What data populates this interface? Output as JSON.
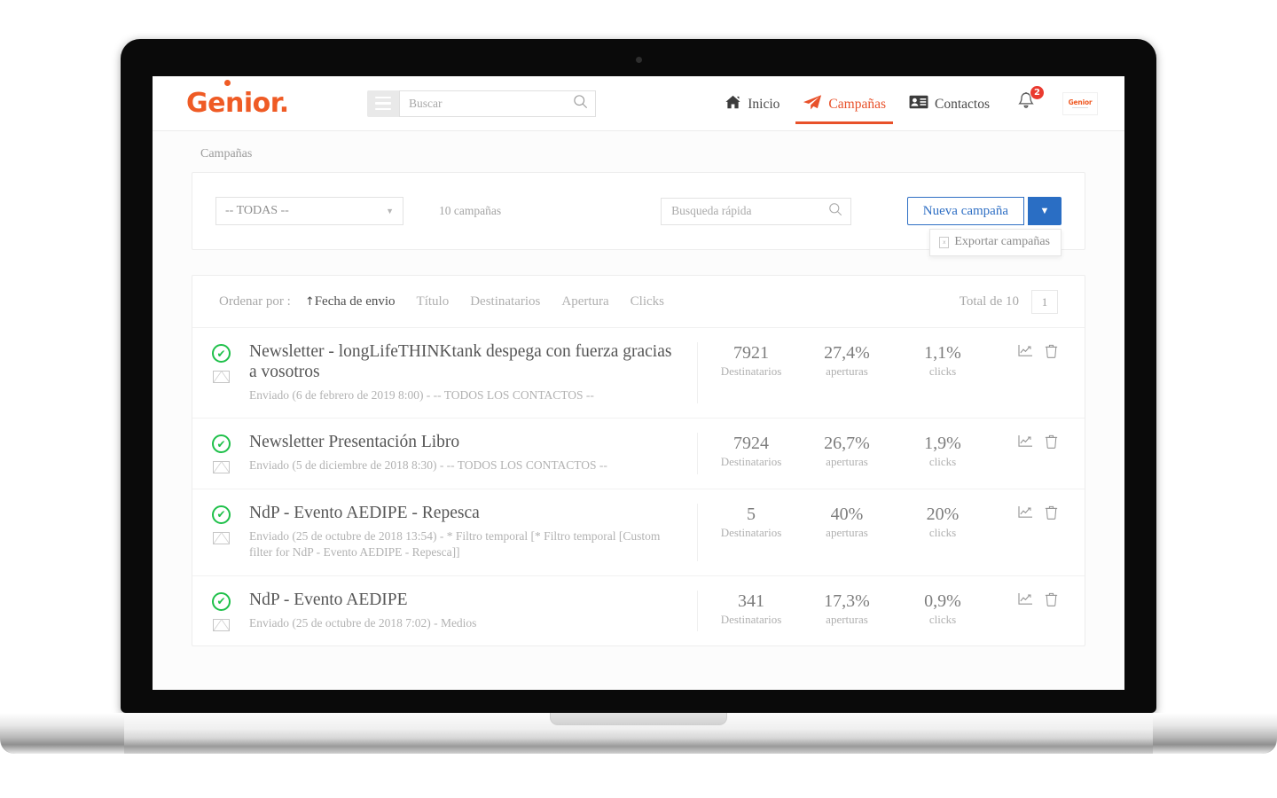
{
  "header": {
    "brand": "Genior",
    "brand_period": ".",
    "menu_icon": "hamburger-icon",
    "search_placeholder": "Buscar",
    "search_value": "",
    "nav": [
      {
        "label": "Inicio",
        "icon": "home-icon",
        "active": false
      },
      {
        "label": "Campañas",
        "icon": "paper-plane-icon",
        "active": true
      },
      {
        "label": "Contactos",
        "icon": "contact-card-icon",
        "active": false
      }
    ],
    "notifications_count": "2",
    "avatar_label": "Genior"
  },
  "breadcrumb": "Campañas",
  "filters": {
    "select_value": "-- TODAS --",
    "campaign_count": "10 campañas",
    "quick_search_placeholder": "Busqueda rápida",
    "quick_search_value": "",
    "new_campaign_label": "Nueva campaña",
    "dropdown_caret": "▼",
    "export_label": "Exportar campañas"
  },
  "sort": {
    "label": "Ordenar por :",
    "options": [
      {
        "label": "Fecha de envio",
        "active": true,
        "arrow": "↑"
      },
      {
        "label": "Título",
        "active": false,
        "arrow": ""
      },
      {
        "label": "Destinatarios",
        "active": false,
        "arrow": ""
      },
      {
        "label": "Apertura",
        "active": false,
        "arrow": ""
      },
      {
        "label": "Clicks",
        "active": false,
        "arrow": ""
      }
    ],
    "total_label": "Total de 10",
    "page_number": "1"
  },
  "stat_labels": {
    "recipients": "Destinatarios",
    "opens": "aperturas",
    "clicks": "clicks"
  },
  "campaigns": [
    {
      "title": "Newsletter - longLifeTHINKtank despega con fuerza gracias a vosotros",
      "subtitle": "Enviado (6 de febrero de 2019 8:00) - -- TODOS LOS CONTACTOS --",
      "recipients": "7921",
      "opens": "27,4%",
      "clicks": "1,1%",
      "status": "sent"
    },
    {
      "title": "Newsletter Presentación Libro",
      "subtitle": "Enviado (5 de diciembre de 2018 8:30) - -- TODOS LOS CONTACTOS --",
      "recipients": "7924",
      "opens": "26,7%",
      "clicks": "1,9%",
      "status": "sent"
    },
    {
      "title": "NdP - Evento AEDIPE - Repesca",
      "subtitle": "Enviado (25 de octubre de 2018 13:54) - * Filtro temporal [* Filtro temporal [Custom filter for NdP - Evento AEDIPE - Repesca]]",
      "recipients": "5",
      "opens": "40%",
      "clicks": "20%",
      "status": "sent"
    },
    {
      "title": "NdP - Evento AEDIPE",
      "subtitle": "Enviado (25 de octubre de 2018 7:02) - Medios",
      "recipients": "341",
      "opens": "17,3%",
      "clicks": "0,9%",
      "status": "sent"
    }
  ],
  "colors": {
    "brand": "#ef5b25",
    "accent_active": "#e8512a",
    "primary_button": "#2a6ec4",
    "success": "#1fc04a",
    "badge": "#ea3a2f"
  }
}
